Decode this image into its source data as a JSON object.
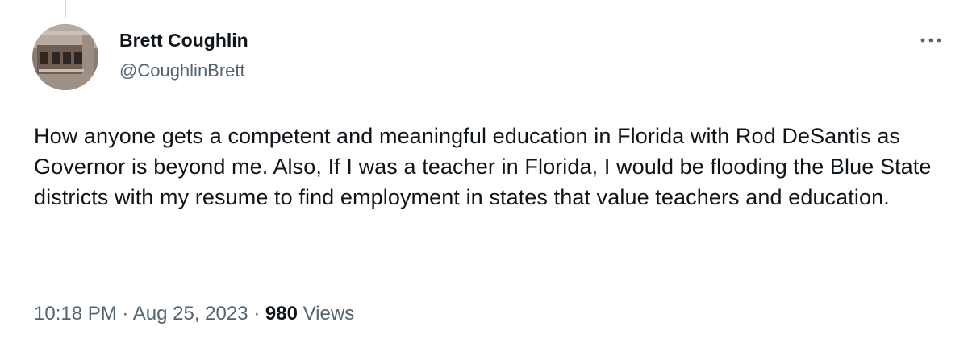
{
  "tweet": {
    "author": {
      "display_name": "Brett Coughlin",
      "handle": "@CoughlinBrett",
      "avatar_icon": "building-photo-avatar"
    },
    "more_icon": "more-horizontal-icon",
    "text": "How anyone gets a competent and meaningful education in Florida with Rod DeSantis as Governor is beyond me. Also, If I was a teacher in Florida, I would be flooding the Blue State districts with my resume to find employment in states that value teachers and education.",
    "time": "10:18 PM",
    "date": "Aug 25, 2023",
    "separator": "·",
    "views_count": "980",
    "views_label": "Views"
  },
  "colors": {
    "text_primary": "#0f1419",
    "text_secondary": "#536471",
    "thread_line": "#cfd9de"
  }
}
